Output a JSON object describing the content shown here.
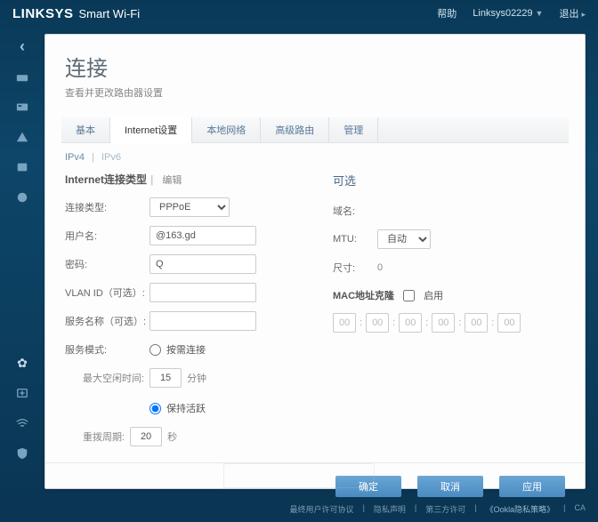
{
  "header": {
    "brand": "LINKSYS",
    "subbrand": "Smart Wi-Fi",
    "help": "帮助",
    "device": "Linksys02229",
    "logout": "退出"
  },
  "page": {
    "title": "连接",
    "subtitle": "查看并更改路由器设置"
  },
  "tabs": [
    "基本",
    "Internet设置",
    "本地网络",
    "高级路由",
    "管理"
  ],
  "subtabs": {
    "ipv4": "IPv4",
    "ipv6": "IPv6"
  },
  "section": {
    "title": "Internet连接类型",
    "edit": "编辑"
  },
  "labels": {
    "conn_type": "连接类型:",
    "username": "用户名:",
    "password": "密码:",
    "vlan": "VLAN ID（可选）:",
    "service": "服务名称（可选）:",
    "svc_mode": "服务模式:",
    "on_demand": "按需连接",
    "max_idle": "最大空闲时间:",
    "minutes": "分钟",
    "keepalive": "保持活跃",
    "redial": "重拨周期:",
    "seconds": "秒"
  },
  "values": {
    "conn_type": "PPPoE",
    "username": "@163.gd",
    "password": "Q",
    "vlan": "",
    "service": "",
    "max_idle": "15",
    "redial": "20"
  },
  "optional": {
    "title": "可选",
    "domain": "域名:",
    "mtu": "MTU:",
    "mtu_val": "自动",
    "size": "尺寸:",
    "size_val": "0",
    "mac_clone": "MAC地址克隆",
    "enable": "启用",
    "mac": [
      "00",
      "00",
      "00",
      "00",
      "00",
      "00"
    ]
  },
  "buttons": {
    "ok": "确定",
    "cancel": "取消",
    "apply": "应用"
  },
  "footer": {
    "eula": "最终用户许可协议",
    "priv": "隐私声明",
    "third": "第三方许可",
    "ookla": "《Ookla隐私策略》",
    "ca": "CA"
  }
}
